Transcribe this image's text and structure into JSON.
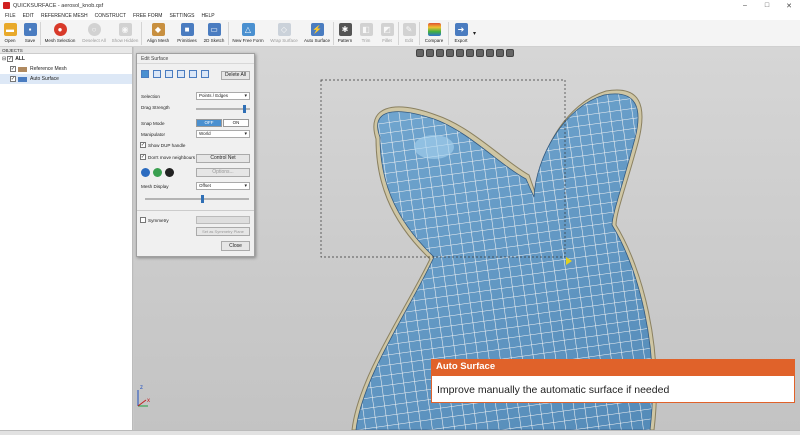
{
  "window": {
    "title": "QUICKSURFACE - aerosol_knob.qsf"
  },
  "menu": [
    "FILE",
    "EDIT",
    "REFERENCE MESH",
    "CONSTRUCT",
    "FREE FORM",
    "SETTINGS",
    "HELP"
  ],
  "toolbar": [
    {
      "label": "Open",
      "icon": "folder-icon",
      "color": "#e8a92a"
    },
    {
      "label": "Save",
      "icon": "save-icon",
      "color": "#4a7cc0"
    },
    {
      "label": "Mesh Selection",
      "icon": "mesh-selection-icon",
      "color": "#d83a2a"
    },
    {
      "label": "Deselect All",
      "icon": "deselect-icon",
      "color": "#aaaaaa"
    },
    {
      "label": "Show Hidden",
      "icon": "eye-icon",
      "color": "#aaaaaa"
    },
    {
      "label": "Align Mesh",
      "icon": "align-mesh-icon",
      "color": "#c89040"
    },
    {
      "label": "Primitives",
      "icon": "primitives-icon",
      "color": "#4a7cc0"
    },
    {
      "label": "2D Sketch",
      "icon": "sketch-icon",
      "color": "#4a7cc0"
    },
    {
      "label": "New Free Form",
      "icon": "free-form-icon",
      "color": "#4a90d0"
    },
    {
      "label": "Wrap Surface",
      "icon": "wrap-surface-icon",
      "color": "#9aa9bb"
    },
    {
      "label": "Auto Surface",
      "icon": "auto-surface-icon",
      "color": "#4a7cc0"
    },
    {
      "label": "Pattern",
      "icon": "pattern-icon",
      "color": "#555555"
    },
    {
      "label": "Trim",
      "icon": "trim-icon",
      "color": "#aaaaaa"
    },
    {
      "label": "Fillet",
      "icon": "fillet-icon",
      "color": "#aaaaaa"
    },
    {
      "label": "Edit",
      "icon": "edit-icon",
      "color": "#aaaaaa"
    },
    {
      "label": "Compare",
      "icon": "compare-icon",
      "color": "#e05030"
    },
    {
      "label": "Export",
      "icon": "export-icon",
      "color": "#4a7cc0"
    }
  ],
  "objects": {
    "header": "OBJECTS",
    "root": "ALL",
    "items": [
      "Reference Mesh",
      "Auto Surface"
    ]
  },
  "edit_surface": {
    "title": "Edit Surface",
    "delete_all": "Delete All",
    "selection_label": "Selection",
    "selection_value": "Points / Edges",
    "drag_strength_label": "Drag Strength",
    "drag_strength": 0.92,
    "snap_mode_label": "Snap Mode",
    "snap_off": "OFF",
    "snap_on": "ON",
    "manipulator_label": "Manipulator",
    "manipulator_value": "World",
    "show_dup_handle": "Show DUP handle",
    "dont_move_neighbours": "Don't move neighbours",
    "control_net": "Control Net",
    "options": "Options...",
    "mesh_display_label": "Mesh Display",
    "mesh_display_value": "Offset",
    "mesh_display_level": 0.55,
    "symmetry": "Symmetry",
    "set_symmetry_plane": "Set as Symmetry Plane",
    "close": "Close"
  },
  "banner": {
    "title": "Auto Surface",
    "text": "Improve manually the automatic surface if needed"
  },
  "axes": {
    "x": "x",
    "y": "y",
    "z": "z"
  }
}
